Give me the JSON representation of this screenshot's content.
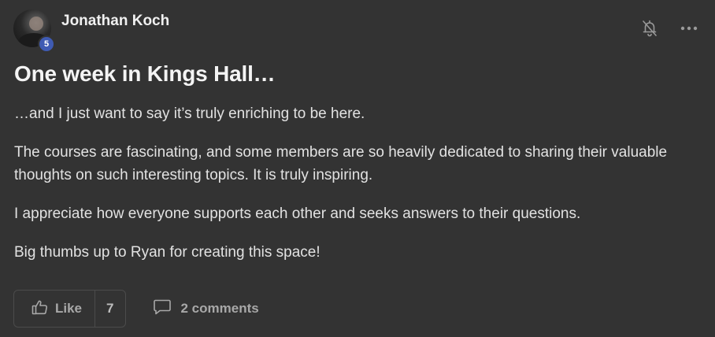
{
  "post": {
    "author": {
      "name": "Jonathan Koch",
      "level": "5",
      "avatar_icon": "user-avatar"
    },
    "title": "One week in Kings Hall…",
    "paragraphs": [
      "…and I just want to say it’s truly enriching to be here.",
      "The courses are fascinating, and some members are so heavily dedicated to sharing their valuable thoughts on such interesting topics. It is truly inspiring.",
      "I appreciate how everyone supports each other and seeks answers to their questions.",
      "Big thumbs up to Ryan for creating this space!"
    ],
    "actions": {
      "like_label": "Like",
      "like_count": "7",
      "comments_label": "2 comments"
    },
    "icons": {
      "notification": "bell-off-icon",
      "more": "more-options-icon",
      "like": "thumbs-up-icon",
      "comment": "comment-icon"
    },
    "colors": {
      "background": "#333333",
      "level_badge": "#3f5bb3",
      "text": "#e2e2e2",
      "muted": "#a8a8a8"
    }
  }
}
